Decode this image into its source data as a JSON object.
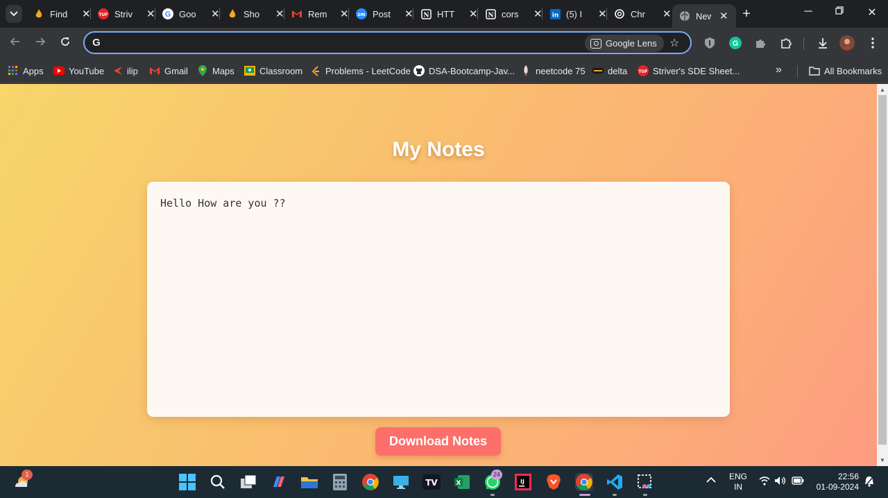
{
  "browser": {
    "tabs": [
      {
        "title": "Find",
        "icon": "flame-icon",
        "color": "#f5a623"
      },
      {
        "title": "Striv",
        "icon": "tuf-icon",
        "color": "#e3242b"
      },
      {
        "title": "Goo",
        "icon": "google-icon",
        "color": "#4285f4"
      },
      {
        "title": "Sho",
        "icon": "flame-icon",
        "color": "#f5a623"
      },
      {
        "title": "Rem",
        "icon": "gmail-icon",
        "color": "#ea4335"
      },
      {
        "title": "Post",
        "icon": "zm-icon",
        "color": "#2d8cff"
      },
      {
        "title": "HTT",
        "icon": "notion-icon",
        "color": "#ffffff"
      },
      {
        "title": "cors",
        "icon": "notion-icon",
        "color": "#ffffff"
      },
      {
        "title": "(5) I",
        "icon": "linkedin-icon",
        "color": "#0a66c2"
      },
      {
        "title": "Chr",
        "icon": "openai-icon",
        "color": "#ffffff"
      },
      {
        "title": "New",
        "icon": "globe-icon",
        "color": "#9aa0a6"
      }
    ],
    "active_tab_index": 10,
    "omnibox": {
      "value": "",
      "placeholder": ""
    },
    "lens_label": "Google Lens",
    "bookmarks": [
      {
        "label": "Apps",
        "icon": "apps-grid-icon"
      },
      {
        "label": "YouTube",
        "icon": "youtube-icon"
      },
      {
        "label": "ilip",
        "icon": "bookmark-red-icon"
      },
      {
        "label": "Gmail",
        "icon": "gmail-icon"
      },
      {
        "label": "Maps",
        "icon": "maps-pin-icon"
      },
      {
        "label": "Classroom",
        "icon": "classroom-icon"
      },
      {
        "label": "Problems - LeetCode",
        "icon": "leetcode-icon"
      },
      {
        "label": "DSA-Bootcamp-Jav...",
        "icon": "github-icon"
      },
      {
        "label": "neetcode 75",
        "icon": "rocket-icon"
      },
      {
        "label": "delta",
        "icon": "delta-icon"
      },
      {
        "label": "Striver's SDE Sheet...",
        "icon": "tuf-icon"
      }
    ],
    "all_bookmarks_label": "All Bookmarks"
  },
  "page": {
    "title": "My Notes",
    "note_text": "Hello How are you ??",
    "download_label": "Download Notes",
    "colors": {
      "button": "#fd6f6a",
      "gradient_start": "#f7d66b",
      "gradient_end": "#fd9c80"
    }
  },
  "taskbar": {
    "weather_badge": "1",
    "whatsapp_badge": "24",
    "language": "ENG",
    "region": "IN",
    "time": "22:56",
    "date": "01-09-2024"
  }
}
